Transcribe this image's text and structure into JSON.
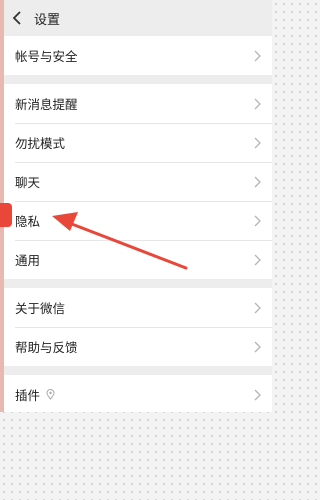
{
  "header": {
    "title": "设置"
  },
  "groups": [
    {
      "items": [
        {
          "label": "帐号与安全"
        }
      ]
    },
    {
      "items": [
        {
          "label": "新消息提醒"
        },
        {
          "label": "勿扰模式"
        },
        {
          "label": "聊天"
        },
        {
          "label": "隐私"
        },
        {
          "label": "通用"
        }
      ]
    },
    {
      "items": [
        {
          "label": "关于微信"
        },
        {
          "label": "帮助与反馈"
        }
      ]
    },
    {
      "items": [
        {
          "label": "插件"
        }
      ]
    }
  ],
  "icons": {
    "back": "chevron-left-icon",
    "row_arrow": "chevron-right-icon",
    "plugin_marker": "location-pin-icon"
  },
  "colors": {
    "annotation_arrow": "#e8473a",
    "background": "#ededed",
    "row_background": "#ffffff"
  }
}
